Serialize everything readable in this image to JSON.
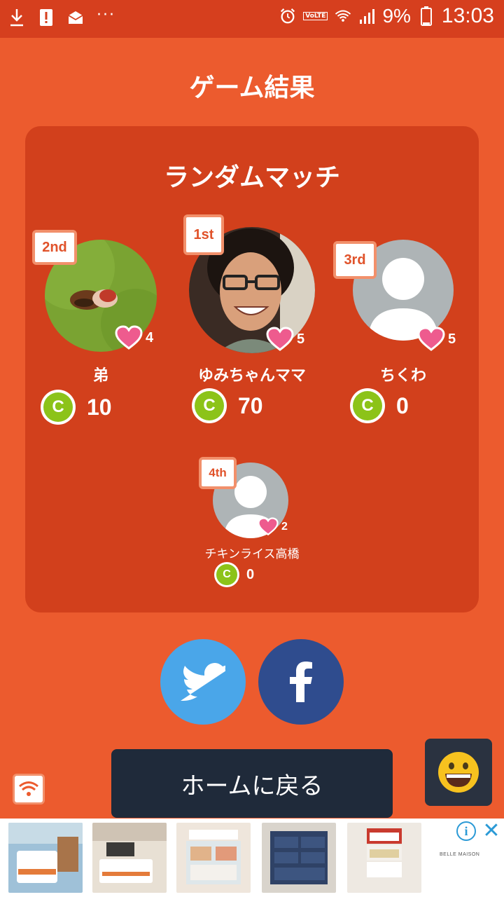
{
  "status_bar": {
    "battery_text": "9%",
    "time": "13:03",
    "volte": "VoLTE",
    "more": "···"
  },
  "page": {
    "title": "ゲーム結果"
  },
  "card": {
    "mode_title": "ランダムマッチ",
    "players": [
      {
        "rank": "2nd",
        "name": "弟",
        "likes": "4",
        "coins": "10"
      },
      {
        "rank": "1st",
        "name": "ゆみちゃんママ",
        "likes": "5",
        "coins": "70"
      },
      {
        "rank": "3rd",
        "name": "ちくわ",
        "likes": "5",
        "coins": "0"
      },
      {
        "rank": "4th",
        "name": "チキンライス高橋",
        "likes": "2",
        "coins": "0"
      }
    ],
    "coin_symbol": "C"
  },
  "home_button": {
    "label": "ホームに戻る"
  },
  "ad": {
    "brand": "BELLE MAISON",
    "info": "i",
    "close": "✕"
  },
  "colors": {
    "background": "#ec5b2e",
    "card": "#d2401c",
    "twitter": "#4aa6e9",
    "facebook": "#2f4c8e",
    "home": "#1f2a3a"
  }
}
